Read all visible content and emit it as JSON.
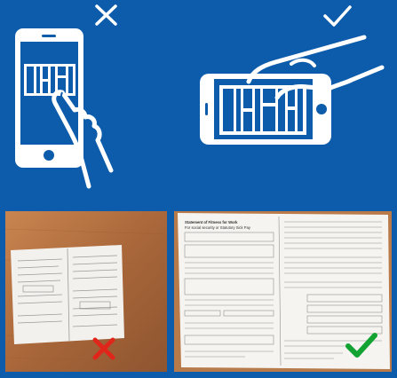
{
  "colors": {
    "background": "#0d5cab",
    "icon_white": "#ffffff",
    "wrong_mark": "#e0251b",
    "right_mark": "#12a332",
    "table_wood": "#b5703f"
  },
  "top_left": {
    "icon": "phone-portrait-hand-icon",
    "verdict_icon": "cross-icon",
    "verdict": "wrong"
  },
  "top_right": {
    "icon": "phone-landscape-hand-icon",
    "verdict_icon": "check-icon",
    "verdict": "correct"
  },
  "bottom_left": {
    "content": "photo of form taken from too far away on wooden table",
    "verdict_icon": "red-cross-icon"
  },
  "bottom_right": {
    "content": "close-up photo of form filling the frame",
    "verdict_icon": "green-check-icon",
    "form_title": "Statement of Fitness for Work",
    "form_subtitle": "For social security or Statutory Sick Pay"
  }
}
